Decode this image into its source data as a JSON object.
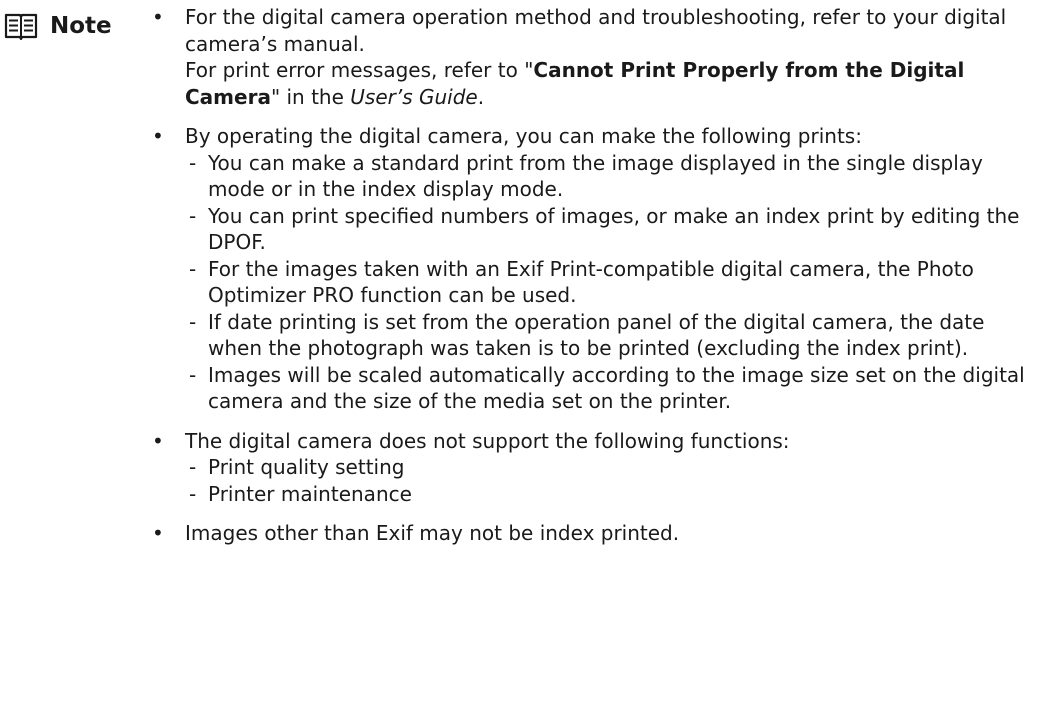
{
  "note": {
    "icon": "book-icon",
    "label": "Note"
  },
  "bullets": [
    {
      "line1": "For the digital camera operation method and troubleshooting, refer to your digital camera’s manual.",
      "line2_prefix": "For print error messages, refer to \"",
      "line2_bold": "Cannot Print Properly from the Digital Camera",
      "line2_mid": "\" in the ",
      "line2_italic": "User’s Guide",
      "line2_suffix": "."
    },
    {
      "text": "By operating the digital camera, you can make the following prints:",
      "items": [
        "You can make a standard print from the image displayed in the single display mode or in the index display mode.",
        "You can print specified numbers of images, or make an index print by editing the DPOF.",
        "For the images taken with an Exif Print-compatible digital camera, the Photo Optimizer PRO function can be used.",
        "If date printing is set from the operation panel of the digital camera, the date when the photograph was taken is to be printed (excluding the index print).",
        "Images will be scaled automatically according to the image size set on the digital camera and the size of the media set on the printer."
      ]
    },
    {
      "text": "The digital camera does not support the following functions:",
      "items": [
        "Print quality setting",
        "Printer maintenance"
      ]
    },
    {
      "text": "Images other than Exif may not be index printed."
    }
  ],
  "symbols": {
    "bullet": "•",
    "dash": "-"
  }
}
